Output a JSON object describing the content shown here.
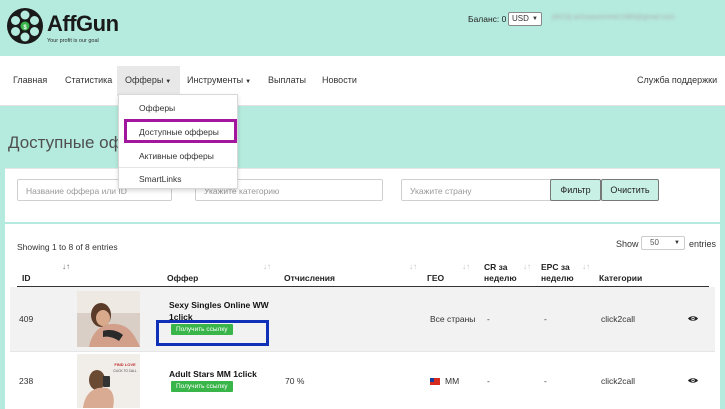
{
  "brand": {
    "name": "AffGun",
    "tagline": "Your profit is our goal"
  },
  "header": {
    "balance_label": "Баланс: 0",
    "currency": "USD",
    "user_email": "[#419] acfusaurenmer1980@gmail.com"
  },
  "nav": {
    "items": [
      "Главная",
      "Статистика",
      "Офферы",
      "Инструменты",
      "Выплаты",
      "Новости"
    ],
    "support": "Служба поддержки"
  },
  "dropdown": {
    "items": [
      "Офферы",
      "Доступные офферы",
      "Активные офферы",
      "SmartLinks"
    ]
  },
  "page": {
    "title": "Доступные офферы"
  },
  "filters": {
    "offer_placeholder": "Название оффера или ID",
    "category_placeholder": "Укажите категорию",
    "country_placeholder": "Укажите страну",
    "filter_button": "Фильтр",
    "clear_button": "Очистить"
  },
  "table": {
    "showing": "Showing 1 to 8 of 8 entries",
    "show_label": "Show",
    "page_length": "50",
    "entries_label": "entries",
    "columns": {
      "id": "ID",
      "offer": "Оффер",
      "payout": "Отчисления",
      "geo": "ГЕО",
      "cr_line1": "CR за",
      "cr_line2": "неделю",
      "epc_line1": "EPC за",
      "epc_line2": "неделю",
      "categories": "Категории"
    },
    "rows": [
      {
        "id": "409",
        "name": "Sexy Singles Online WW 1click",
        "link_label": "Получить ссылку",
        "payout": "",
        "geo": "Все страны",
        "cr": "-",
        "epc": "-",
        "category": "click2call"
      },
      {
        "id": "238",
        "name": "Adult Stars MM 1click",
        "link_label": "Получить ссылку",
        "payout": "70 %",
        "geo": "MM",
        "cr": "-",
        "epc": "-",
        "category": "click2call",
        "thumb_text_1": "FIND LOVE",
        "thumb_text_2": "CLICK TO CALL"
      }
    ]
  },
  "colors": {
    "header_bg": "#b5ebde",
    "dropdown_highlight": "#a3169e",
    "annotation_box": "#1130b8",
    "link_button": "#39b54a"
  }
}
